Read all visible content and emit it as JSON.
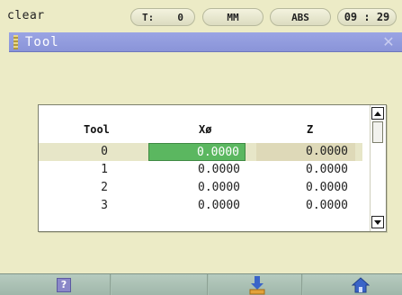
{
  "status": {
    "message": "clear",
    "tool_label": "T:",
    "tool_value": "0",
    "unit": "MM",
    "mode": "ABS",
    "time": "09 : 29"
  },
  "window": {
    "title": "Tool",
    "close_icon": "close-icon"
  },
  "table": {
    "headers": {
      "tool": "Tool",
      "x": "Xø",
      "z": "Z"
    },
    "rows": [
      {
        "tool": "0",
        "x": "0.0000",
        "z": "0.0000"
      },
      {
        "tool": "1",
        "x": "0.0000",
        "z": "0.0000"
      },
      {
        "tool": "2",
        "x": "0.0000",
        "z": "0.0000"
      },
      {
        "tool": "3",
        "x": "0.0000",
        "z": "0.0000"
      }
    ],
    "selected_row": 0,
    "active_cell": "x"
  },
  "softkeys": [
    {
      "icon": "help-icon",
      "label": "?"
    },
    {
      "icon": "",
      "label": ""
    },
    {
      "icon": "import-icon",
      "label": ""
    },
    {
      "icon": "home-icon",
      "label": ""
    }
  ],
  "colors": {
    "background": "#ecebc6",
    "titlebar": "#8a94d8",
    "active_cell": "#5bb760",
    "softkey_bar": "#a9c0b3"
  }
}
